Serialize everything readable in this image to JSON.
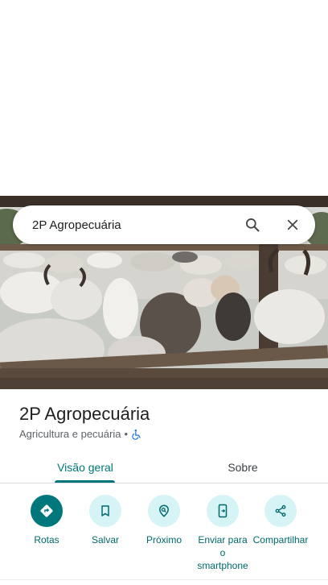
{
  "search": {
    "query": "2P Agropecuária"
  },
  "place": {
    "title": "2P Agropecuária",
    "category": "Agricultura e pecuária",
    "separator": "•"
  },
  "tabs": [
    {
      "label": "Visão geral",
      "selected": true
    },
    {
      "label": "Sobre",
      "selected": false
    }
  ],
  "actions": [
    {
      "label": "Rotas",
      "icon": "directions-icon"
    },
    {
      "label": "Salvar",
      "icon": "bookmark-icon"
    },
    {
      "label": "Próximo",
      "icon": "nearby-icon"
    },
    {
      "label": "Enviar para o smartphone",
      "icon": "send-to-phone-icon"
    },
    {
      "label": "Compartilhar",
      "icon": "share-icon"
    }
  ],
  "colors": {
    "accent": "#00777a",
    "action_bg": "#d6f3f6",
    "text_primary": "#1f1f1f",
    "text_secondary": "#5f6368"
  }
}
